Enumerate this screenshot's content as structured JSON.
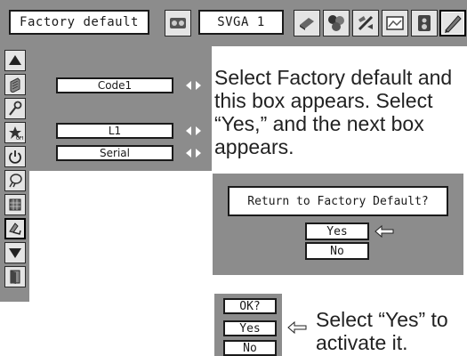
{
  "menu_bar": {
    "title": "Factory default",
    "signal": "SVGA 1",
    "icons": [
      "pc-adjust-icon",
      "computer-input-icon",
      "color-adjust-icon",
      "screen-icon",
      "image-select-icon",
      "speaker-icon",
      "setting-icon"
    ]
  },
  "side_menu": {
    "icons": [
      "scroll-up-icon",
      "language-icon",
      "keystone-icon",
      "blank-off-icon",
      "power-icon",
      "lamp-icon",
      "filter-icon",
      "factory-default-icon",
      "scroll-down-icon",
      "exit-icon"
    ]
  },
  "submenu": {
    "fields": [
      {
        "value": "Code1"
      },
      {
        "value": "L1"
      },
      {
        "value": "Serial"
      }
    ]
  },
  "instructions": {
    "top_text": "Select Factory default and this box appears.  Select “Yes,” and the next box appears.",
    "bottom_text": "Select “Yes” to activate it."
  },
  "factory_dialog": {
    "title": "Return to Factory Default?",
    "yes_label": "Yes",
    "no_label": "No"
  },
  "ok_dialog": {
    "title": "OK?",
    "yes_label": "Yes",
    "no_label": "No"
  },
  "colors": {
    "panel": "#8c8c8c",
    "box": "#ffffff",
    "border": "#1a1a1a"
  }
}
